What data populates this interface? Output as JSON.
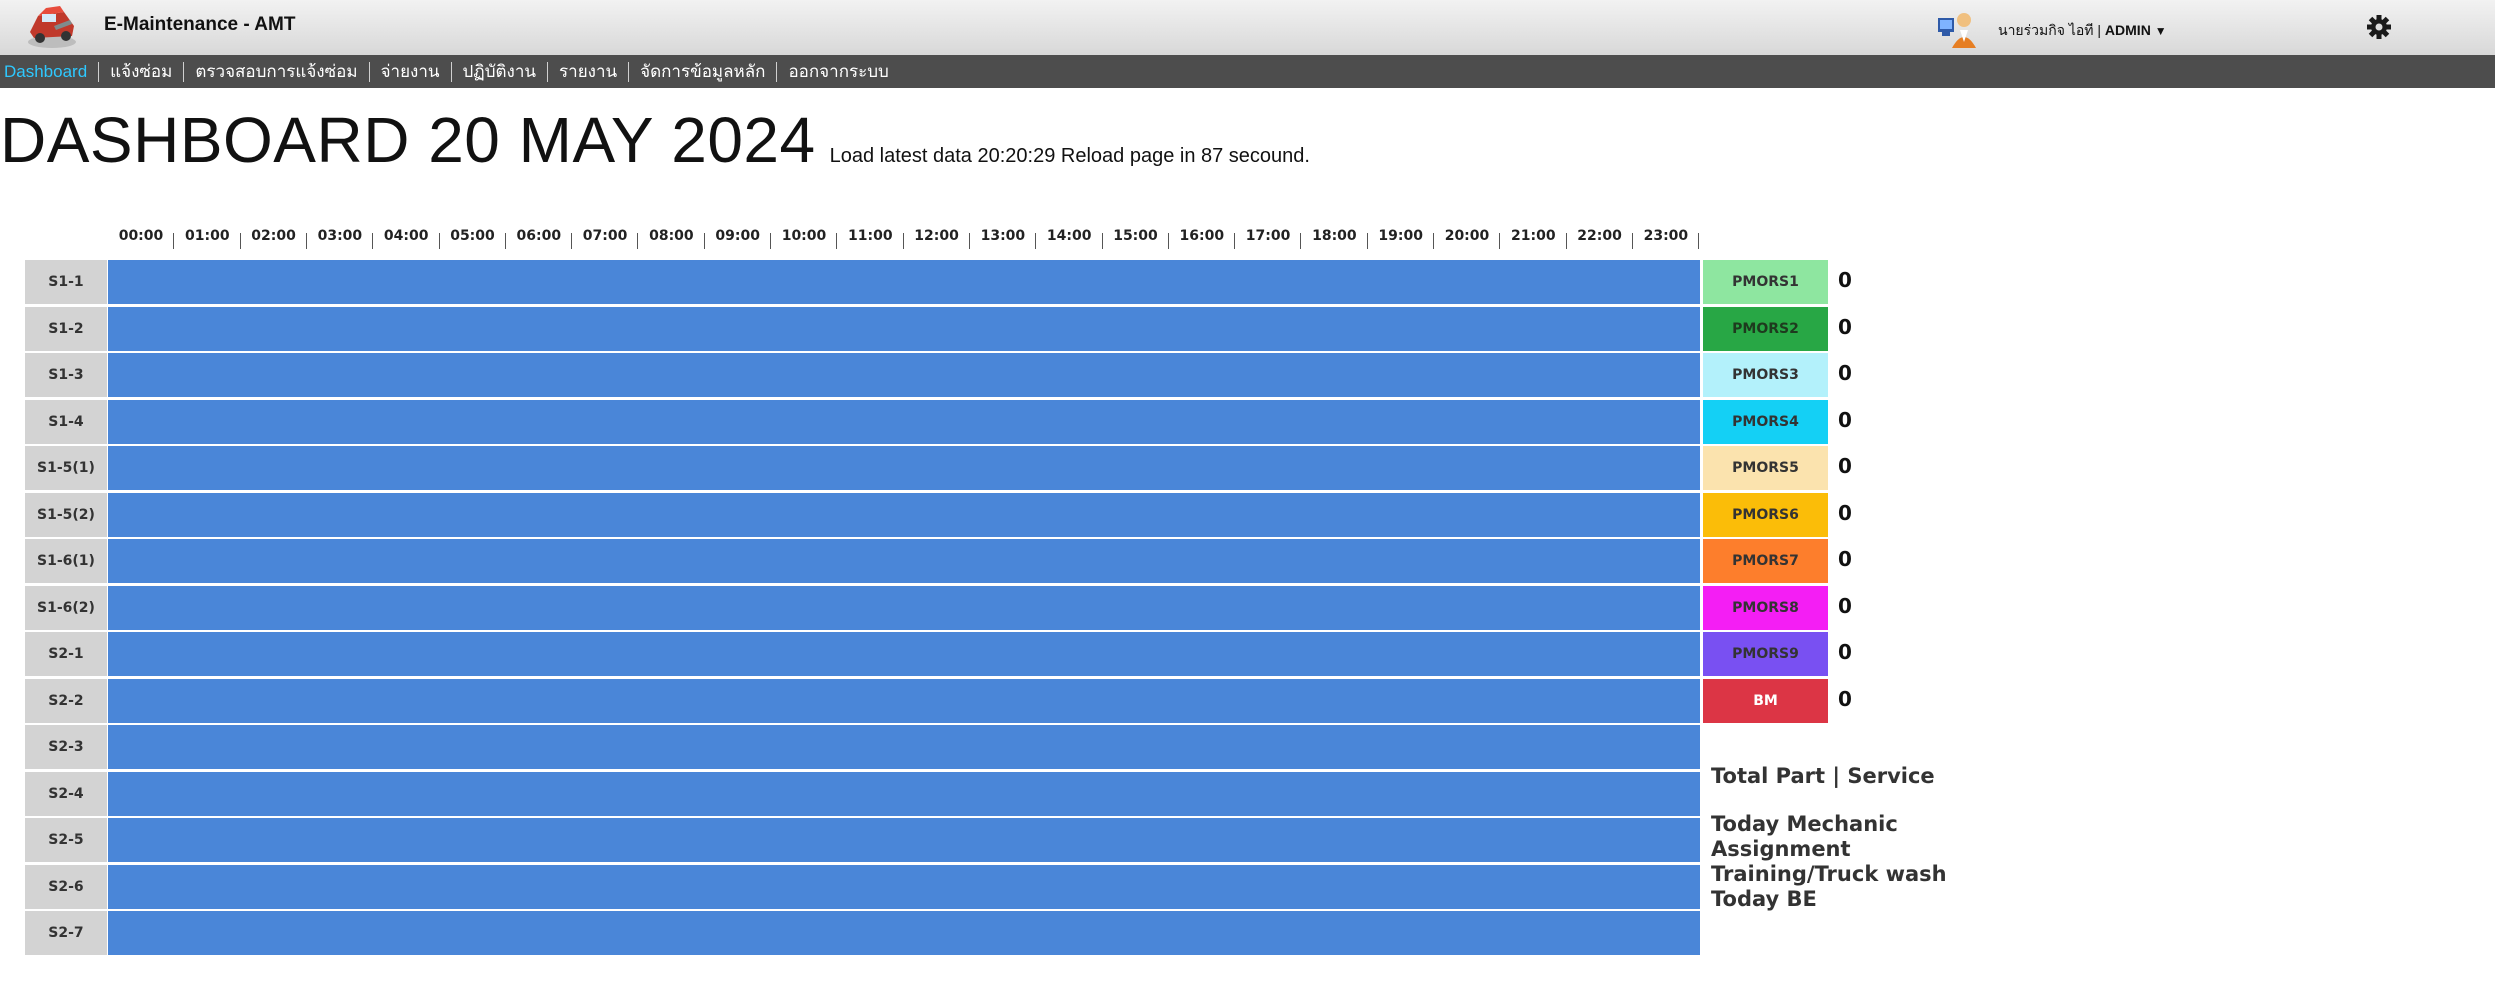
{
  "header": {
    "app_title": "E-Maintenance - AMT",
    "user_name": "นายร่วมกิจ ไอที",
    "user_sep": "|",
    "user_role": "ADMIN",
    "caret": "▼"
  },
  "nav": {
    "items": [
      "Dashboard",
      "แจ้งซ่อม",
      "ตรวจสอบการแจ้งซ่อม",
      "จ่ายงาน",
      "ปฏิบัติงาน",
      "รายงาน",
      "จัดการข้อมูลหลัก",
      "ออกจากระบบ"
    ],
    "active_index": 0,
    "active_color": "#2ec8ff"
  },
  "heading": {
    "title": "DASHBOARD 20 MAY 2024",
    "subtitle": "Load latest data 20:20:29 Reload page in 87 secound."
  },
  "schedule": {
    "hours": [
      "00:00",
      "01:00",
      "02:00",
      "03:00",
      "04:00",
      "05:00",
      "06:00",
      "07:00",
      "08:00",
      "09:00",
      "10:00",
      "11:00",
      "12:00",
      "13:00",
      "14:00",
      "15:00",
      "16:00",
      "17:00",
      "18:00",
      "19:00",
      "20:00",
      "21:00",
      "22:00",
      "23:00"
    ],
    "rows": [
      "S1-1",
      "S1-2",
      "S1-3",
      "S1-4",
      "S1-5(1)",
      "S1-5(2)",
      "S1-6(1)",
      "S1-6(2)",
      "S2-1",
      "S2-2",
      "S2-3",
      "S2-4",
      "S2-5",
      "S2-6",
      "S2-7"
    ],
    "bar_color": "#4a86d8"
  },
  "legend": [
    {
      "label": "PMORS1",
      "color": "#8ee6a0",
      "text_color": "#333333",
      "count": "0"
    },
    {
      "label": "PMORS2",
      "color": "#28a745",
      "text_color": "#1e3a1e",
      "count": "0"
    },
    {
      "label": "PMORS3",
      "color": "#b3f1fb",
      "text_color": "#333333",
      "count": "0"
    },
    {
      "label": "PMORS4",
      "color": "#14d0f5",
      "text_color": "#333333",
      "count": "0"
    },
    {
      "label": "PMORS5",
      "color": "#fbe3ae",
      "text_color": "#333333",
      "count": "0"
    },
    {
      "label": "PMORS6",
      "color": "#fbbd08",
      "text_color": "#333333",
      "count": "0"
    },
    {
      "label": "PMORS7",
      "color": "#fd7e2c",
      "text_color": "#333333",
      "count": "0"
    },
    {
      "label": "PMORS8",
      "color": "#f41ef4",
      "text_color": "#333333",
      "count": "0"
    },
    {
      "label": "PMORS9",
      "color": "#7950f2",
      "text_color": "#333333",
      "count": "0"
    },
    {
      "label": "BM",
      "color": "#dc3545",
      "text_color": "#ffffff",
      "count": "0"
    }
  ],
  "info": {
    "total_part": "Total Part | Service",
    "mechanic": "Today Mechanic Assignment",
    "training": "Training/Truck wash",
    "be": "Today BE"
  },
  "icons": {
    "logo": "truck-logo-icon",
    "avatar": "user-avatar-icon",
    "settings": "gear-icon"
  }
}
